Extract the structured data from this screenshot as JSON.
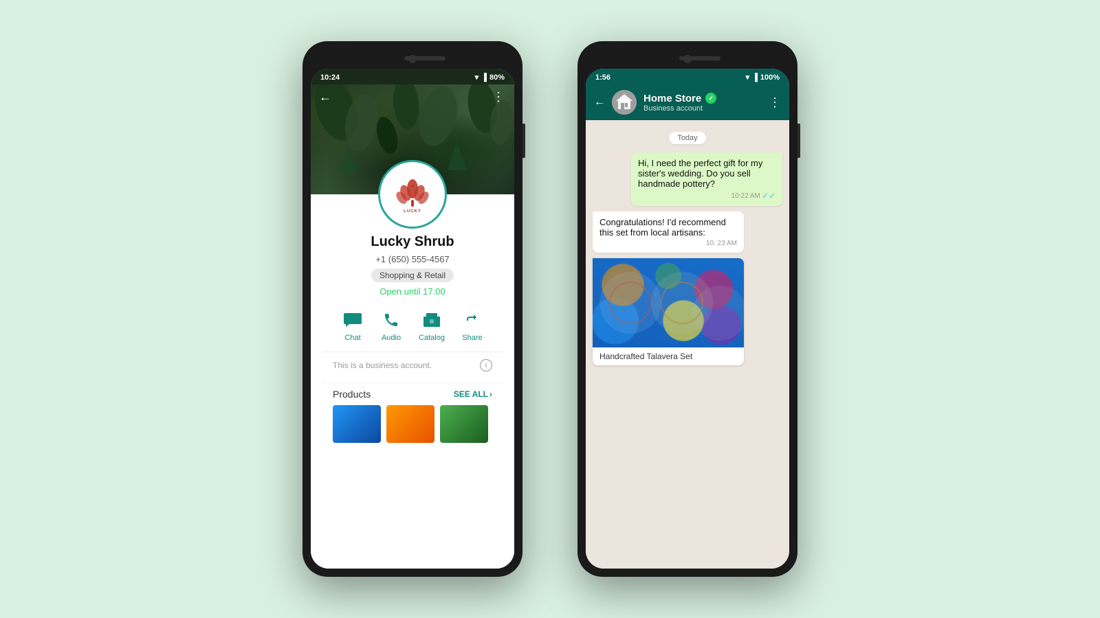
{
  "background": "#d8f0e0",
  "phone1": {
    "status_bar": {
      "time": "10:24",
      "battery": "80%"
    },
    "profile": {
      "name": "Lucky Shrub",
      "phone": "+1 (650) 555-4567",
      "category": "Shopping & Retail",
      "open_status": "Open until 17:00",
      "actions": [
        {
          "id": "chat",
          "label": "Chat",
          "icon": "💬"
        },
        {
          "id": "audio",
          "label": "Audio",
          "icon": "📞"
        },
        {
          "id": "catalog",
          "label": "Catalog",
          "icon": "🏪"
        },
        {
          "id": "share",
          "label": "Share",
          "icon": "↗"
        }
      ],
      "business_note": "This is a business account.",
      "products_label": "Products",
      "see_all_label": "SEE ALL"
    }
  },
  "phone2": {
    "status_bar": {
      "time": "1:56",
      "battery": "100%"
    },
    "chat": {
      "contact_name": "Home Store",
      "contact_sub": "Business account",
      "verified": true,
      "date_separator": "Today",
      "messages": [
        {
          "id": "msg1",
          "type": "sent",
          "text": "Hi, I need the perfect gift for my sister's wedding. Do you sell handmade pottery?",
          "time": "10:22 AM",
          "read": true
        },
        {
          "id": "msg2",
          "type": "received",
          "text": "Congratulations! I'd recommend this set from local artisans:",
          "time": "10: 23 AM"
        },
        {
          "id": "msg3",
          "type": "product-card",
          "product_name": "Handcrafted Talavera Set"
        }
      ]
    }
  }
}
